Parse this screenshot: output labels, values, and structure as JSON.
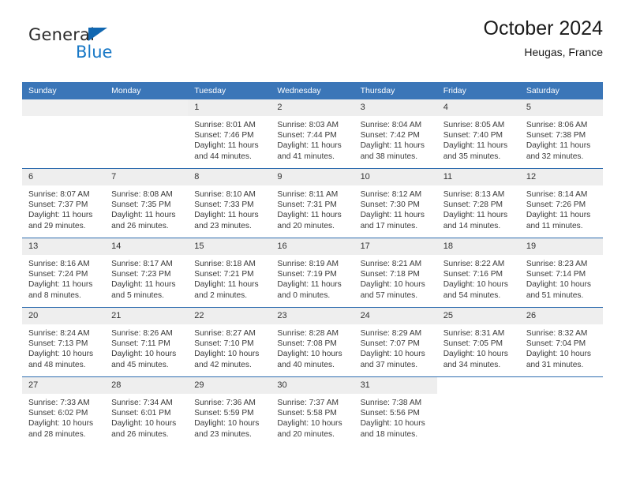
{
  "brand": {
    "name_top": "General",
    "name_bottom": "Blue",
    "accent_color": "#1167b1"
  },
  "header": {
    "title": "October 2024",
    "subtitle": "Heugas, France",
    "header_bg": "#3b76b8",
    "daynum_bg": "#eeeeee",
    "row_divider": "#2f6daf"
  },
  "weekdays": [
    "Sunday",
    "Monday",
    "Tuesday",
    "Wednesday",
    "Thursday",
    "Friday",
    "Saturday"
  ],
  "labels": {
    "sunrise": "Sunrise:",
    "sunset": "Sunset:",
    "daylight": "Daylight:"
  },
  "weeks": [
    [
      {
        "day": "",
        "lines": []
      },
      {
        "day": "",
        "lines": []
      },
      {
        "day": "1",
        "lines": [
          "Sunrise: 8:01 AM",
          "Sunset: 7:46 PM",
          "Daylight: 11 hours",
          "and 44 minutes."
        ]
      },
      {
        "day": "2",
        "lines": [
          "Sunrise: 8:03 AM",
          "Sunset: 7:44 PM",
          "Daylight: 11 hours",
          "and 41 minutes."
        ]
      },
      {
        "day": "3",
        "lines": [
          "Sunrise: 8:04 AM",
          "Sunset: 7:42 PM",
          "Daylight: 11 hours",
          "and 38 minutes."
        ]
      },
      {
        "day": "4",
        "lines": [
          "Sunrise: 8:05 AM",
          "Sunset: 7:40 PM",
          "Daylight: 11 hours",
          "and 35 minutes."
        ]
      },
      {
        "day": "5",
        "lines": [
          "Sunrise: 8:06 AM",
          "Sunset: 7:38 PM",
          "Daylight: 11 hours",
          "and 32 minutes."
        ]
      }
    ],
    [
      {
        "day": "6",
        "lines": [
          "Sunrise: 8:07 AM",
          "Sunset: 7:37 PM",
          "Daylight: 11 hours",
          "and 29 minutes."
        ]
      },
      {
        "day": "7",
        "lines": [
          "Sunrise: 8:08 AM",
          "Sunset: 7:35 PM",
          "Daylight: 11 hours",
          "and 26 minutes."
        ]
      },
      {
        "day": "8",
        "lines": [
          "Sunrise: 8:10 AM",
          "Sunset: 7:33 PM",
          "Daylight: 11 hours",
          "and 23 minutes."
        ]
      },
      {
        "day": "9",
        "lines": [
          "Sunrise: 8:11 AM",
          "Sunset: 7:31 PM",
          "Daylight: 11 hours",
          "and 20 minutes."
        ]
      },
      {
        "day": "10",
        "lines": [
          "Sunrise: 8:12 AM",
          "Sunset: 7:30 PM",
          "Daylight: 11 hours",
          "and 17 minutes."
        ]
      },
      {
        "day": "11",
        "lines": [
          "Sunrise: 8:13 AM",
          "Sunset: 7:28 PM",
          "Daylight: 11 hours",
          "and 14 minutes."
        ]
      },
      {
        "day": "12",
        "lines": [
          "Sunrise: 8:14 AM",
          "Sunset: 7:26 PM",
          "Daylight: 11 hours",
          "and 11 minutes."
        ]
      }
    ],
    [
      {
        "day": "13",
        "lines": [
          "Sunrise: 8:16 AM",
          "Sunset: 7:24 PM",
          "Daylight: 11 hours",
          "and 8 minutes."
        ]
      },
      {
        "day": "14",
        "lines": [
          "Sunrise: 8:17 AM",
          "Sunset: 7:23 PM",
          "Daylight: 11 hours",
          "and 5 minutes."
        ]
      },
      {
        "day": "15",
        "lines": [
          "Sunrise: 8:18 AM",
          "Sunset: 7:21 PM",
          "Daylight: 11 hours",
          "and 2 minutes."
        ]
      },
      {
        "day": "16",
        "lines": [
          "Sunrise: 8:19 AM",
          "Sunset: 7:19 PM",
          "Daylight: 11 hours",
          "and 0 minutes."
        ]
      },
      {
        "day": "17",
        "lines": [
          "Sunrise: 8:21 AM",
          "Sunset: 7:18 PM",
          "Daylight: 10 hours",
          "and 57 minutes."
        ]
      },
      {
        "day": "18",
        "lines": [
          "Sunrise: 8:22 AM",
          "Sunset: 7:16 PM",
          "Daylight: 10 hours",
          "and 54 minutes."
        ]
      },
      {
        "day": "19",
        "lines": [
          "Sunrise: 8:23 AM",
          "Sunset: 7:14 PM",
          "Daylight: 10 hours",
          "and 51 minutes."
        ]
      }
    ],
    [
      {
        "day": "20",
        "lines": [
          "Sunrise: 8:24 AM",
          "Sunset: 7:13 PM",
          "Daylight: 10 hours",
          "and 48 minutes."
        ]
      },
      {
        "day": "21",
        "lines": [
          "Sunrise: 8:26 AM",
          "Sunset: 7:11 PM",
          "Daylight: 10 hours",
          "and 45 minutes."
        ]
      },
      {
        "day": "22",
        "lines": [
          "Sunrise: 8:27 AM",
          "Sunset: 7:10 PM",
          "Daylight: 10 hours",
          "and 42 minutes."
        ]
      },
      {
        "day": "23",
        "lines": [
          "Sunrise: 8:28 AM",
          "Sunset: 7:08 PM",
          "Daylight: 10 hours",
          "and 40 minutes."
        ]
      },
      {
        "day": "24",
        "lines": [
          "Sunrise: 8:29 AM",
          "Sunset: 7:07 PM",
          "Daylight: 10 hours",
          "and 37 minutes."
        ]
      },
      {
        "day": "25",
        "lines": [
          "Sunrise: 8:31 AM",
          "Sunset: 7:05 PM",
          "Daylight: 10 hours",
          "and 34 minutes."
        ]
      },
      {
        "day": "26",
        "lines": [
          "Sunrise: 8:32 AM",
          "Sunset: 7:04 PM",
          "Daylight: 10 hours",
          "and 31 minutes."
        ]
      }
    ],
    [
      {
        "day": "27",
        "lines": [
          "Sunrise: 7:33 AM",
          "Sunset: 6:02 PM",
          "Daylight: 10 hours",
          "and 28 minutes."
        ]
      },
      {
        "day": "28",
        "lines": [
          "Sunrise: 7:34 AM",
          "Sunset: 6:01 PM",
          "Daylight: 10 hours",
          "and 26 minutes."
        ]
      },
      {
        "day": "29",
        "lines": [
          "Sunrise: 7:36 AM",
          "Sunset: 5:59 PM",
          "Daylight: 10 hours",
          "and 23 minutes."
        ]
      },
      {
        "day": "30",
        "lines": [
          "Sunrise: 7:37 AM",
          "Sunset: 5:58 PM",
          "Daylight: 10 hours",
          "and 20 minutes."
        ]
      },
      {
        "day": "31",
        "lines": [
          "Sunrise: 7:38 AM",
          "Sunset: 5:56 PM",
          "Daylight: 10 hours",
          "and 18 minutes."
        ]
      },
      {
        "day": "",
        "lines": []
      },
      {
        "day": "",
        "lines": []
      }
    ]
  ]
}
